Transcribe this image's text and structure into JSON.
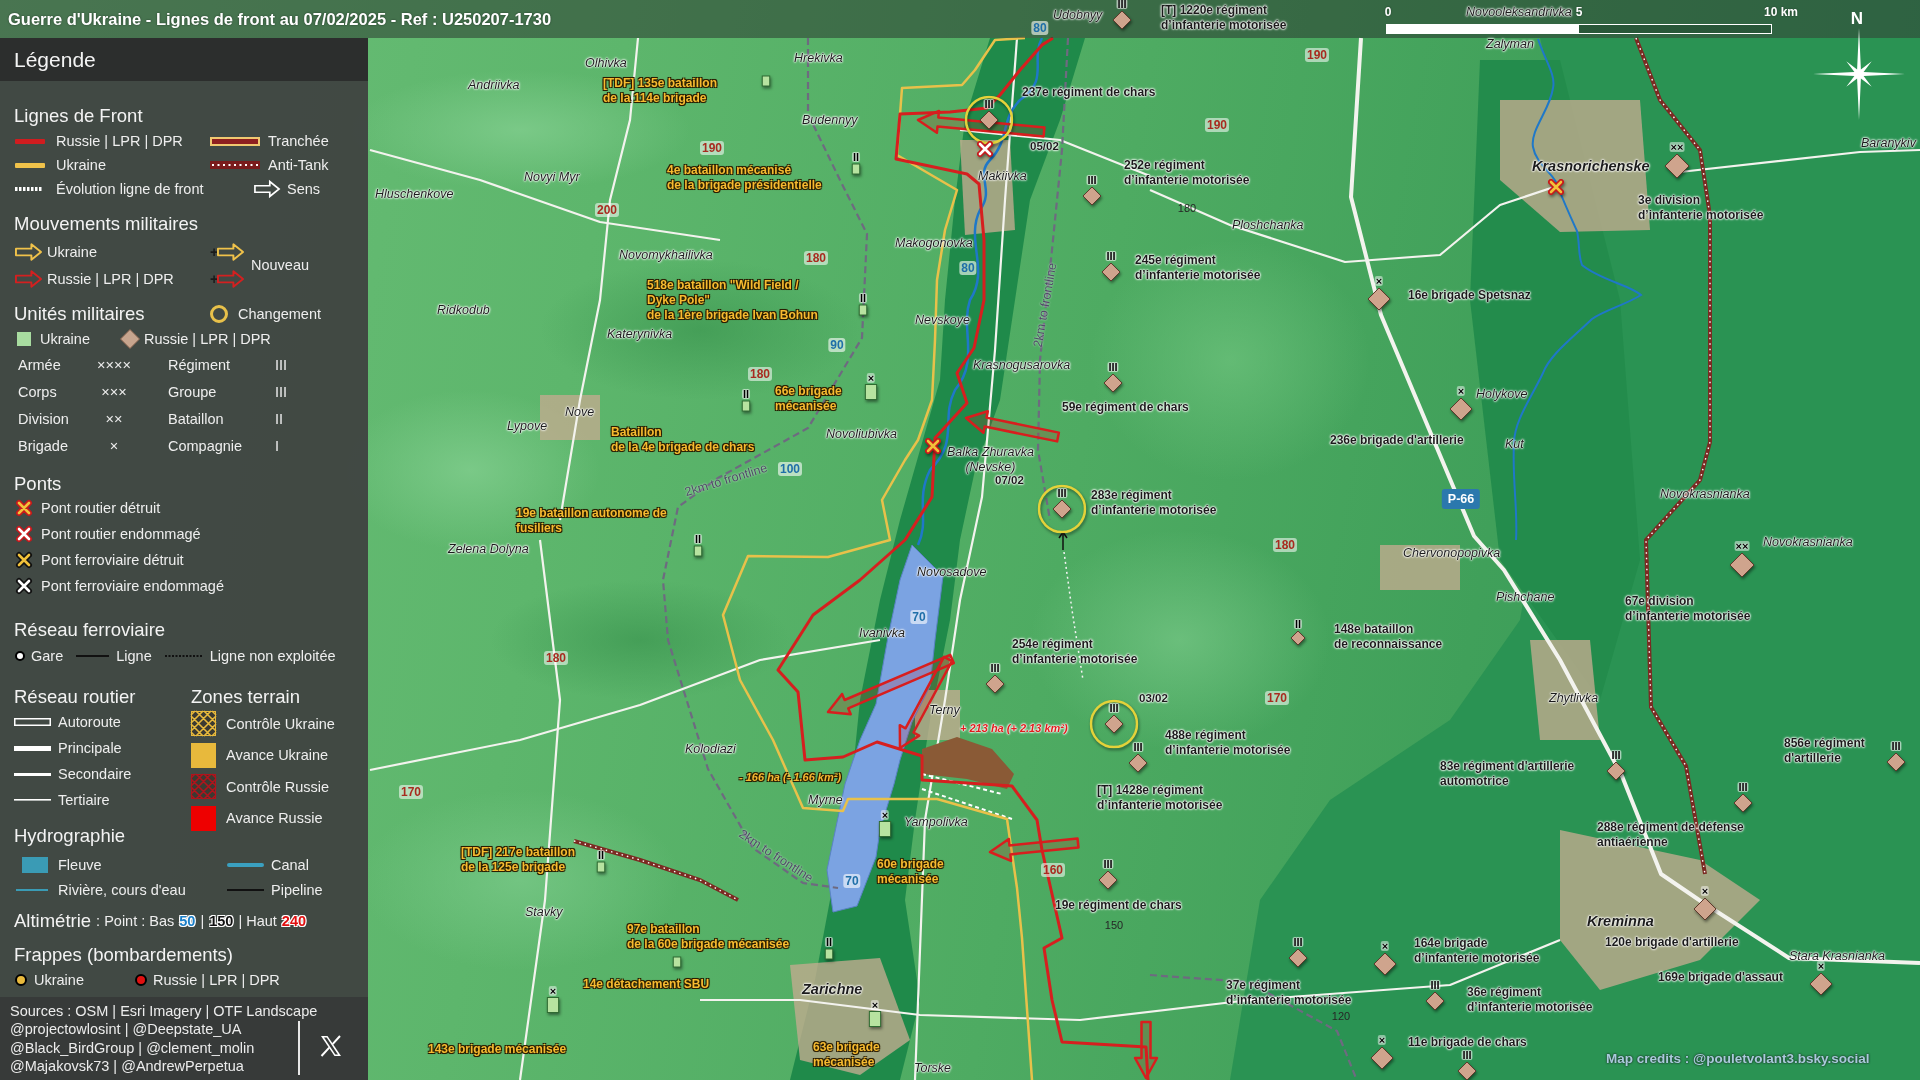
{
  "title": "Guerre d'Ukraine - Lignes de front au 07/02/2025 - Ref : U250207-1730",
  "scale_bar": {
    "labels": [
      "0",
      "5",
      "10 km"
    ]
  },
  "compass": {
    "label": "N"
  },
  "legend": {
    "title": "Légende",
    "front_lines": {
      "title": "Lignes de Front",
      "items": [
        {
          "kind": "line",
          "label": "Russie | LPR | DPR",
          "color": "#d01c1f"
        },
        {
          "kind": "trench",
          "label": "Tranchée"
        },
        {
          "kind": "line",
          "label": "Ukraine",
          "color": "#f0c24a"
        },
        {
          "kind": "antitank",
          "label": "Anti-Tank"
        },
        {
          "kind": "dotted",
          "label": "Évolution ligne de front"
        },
        {
          "kind": "arrow",
          "label": "Sens"
        }
      ]
    },
    "movements": {
      "title": "Mouvements militaires",
      "items": [
        {
          "label": "Ukraine",
          "color": "#f0c24a"
        },
        {
          "label": "Russie | LPR | DPR",
          "color": "#d42020"
        }
      ],
      "new": {
        "label": "Nouveau",
        "items": [
          {
            "sign": "+",
            "color": "#f0c24a"
          },
          {
            "sign": "+",
            "color": "#d42020"
          }
        ]
      }
    },
    "units": {
      "title": "Unités militaires",
      "change": {
        "label": "Changement"
      },
      "sides": [
        {
          "kind": "square",
          "label": "Ukraine"
        },
        {
          "kind": "diamond",
          "label": "Russie | LPR | DPR"
        }
      ],
      "echelons": [
        {
          "name": "Armée",
          "mark": "××××"
        },
        {
          "name": "Régiment",
          "mark": "III"
        },
        {
          "name": "Corps",
          "mark": "×××"
        },
        {
          "name": "Groupe",
          "mark": "III"
        },
        {
          "name": "Division",
          "mark": "××"
        },
        {
          "name": "Bataillon",
          "mark": "II"
        },
        {
          "name": "Brigade",
          "mark": "×"
        },
        {
          "name": "Compagnie",
          "mark": "I"
        }
      ]
    },
    "bridges": {
      "title": "Ponts",
      "items": [
        {
          "kind": "road",
          "destroyed": true,
          "label": "Pont routier détruit"
        },
        {
          "kind": "road",
          "destroyed": false,
          "label": "Pont routier endommagé"
        },
        {
          "kind": "rail",
          "destroyed": true,
          "label": "Pont ferroviaire détruit"
        },
        {
          "kind": "rail",
          "destroyed": false,
          "label": "Pont ferroviaire endommagé"
        }
      ]
    },
    "railway": {
      "title": "Réseau ferroviaire",
      "items": [
        {
          "kind": "station",
          "label": "Gare"
        },
        {
          "kind": "line",
          "label": "Ligne"
        },
        {
          "kind": "dashed",
          "label": "Ligne non exploitée"
        }
      ]
    },
    "roads": {
      "title": "Réseau routier",
      "items": [
        {
          "kind": "motorway",
          "label": "Autoroute"
        },
        {
          "kind": "primary",
          "label": "Principale"
        },
        {
          "kind": "secondary",
          "label": "Secondaire"
        },
        {
          "kind": "tertiary",
          "label": "Tertiaire"
        }
      ]
    },
    "zones": {
      "title": "Zones terrain",
      "items": [
        {
          "kind": "hatched",
          "label": "Contrôle Ukraine",
          "color": "#e8b93c"
        },
        {
          "kind": "solid",
          "label": "Avance Ukraine",
          "color": "#e8b93c"
        },
        {
          "kind": "hatched",
          "label": "Contrôle Russie",
          "color": "#b0141c"
        },
        {
          "kind": "solid",
          "label": "Avance Russie",
          "color": "#ee0000"
        }
      ]
    },
    "hydrography": {
      "title": "Hydrographie",
      "items": [
        {
          "kind": "area",
          "label": "Fleuve"
        },
        {
          "kind": "canal",
          "label": "Canal"
        },
        {
          "kind": "stream",
          "label": "Rivière, cours d'eau"
        },
        {
          "kind": "pipeline",
          "label": "Pipeline"
        }
      ]
    },
    "altimetry": {
      "title": "Altimétrie",
      "parts": [
        {
          "kind": "text",
          "text": ": Point : Bas"
        },
        {
          "kind": "low",
          "text": "50"
        },
        {
          "kind": "text",
          "text": "|"
        },
        {
          "kind": "mid",
          "text": "150"
        },
        {
          "kind": "text",
          "text": "| Haut"
        },
        {
          "kind": "high",
          "text": "240"
        }
      ]
    },
    "strikes": {
      "title": "Frappes (bombardements)",
      "items": [
        {
          "label": "Ukraine",
          "color": "#e8b93c"
        },
        {
          "label": "Russie | LPR | DPR",
          "color": "#e01010"
        }
      ]
    },
    "sources": [
      "Sources : OSM | Esri Imagery | OTF Landscape",
      "@projectowlosint | @Deepstate_UA",
      "@Black_BirdGroup | @clement_molin",
      "@Majakovsk73 | @AndrewPerpetua"
    ]
  },
  "map": {
    "places": [
      {
        "name": "Udobnyy",
        "kind": "village"
      },
      {
        "name": "Novooleksandrivka",
        "kind": "village"
      },
      {
        "name": "Zalyman",
        "kind": "village"
      },
      {
        "name": "Olhivka",
        "kind": "village"
      },
      {
        "name": "Hrekivka",
        "kind": "village"
      },
      {
        "name": "Andriivka",
        "kind": "village"
      },
      {
        "name": "Budennyy",
        "kind": "village"
      },
      {
        "name": "Baranykiv",
        "kind": "village"
      },
      {
        "name": "Krasnorichenske",
        "kind": "town"
      },
      {
        "name": "Novyi Myr",
        "kind": "village"
      },
      {
        "name": "Makiivka",
        "kind": "village"
      },
      {
        "name": "Hluschenkove",
        "kind": "village"
      },
      {
        "name": "Ploshchanka",
        "kind": "village"
      },
      {
        "name": "Makogonovka",
        "kind": "village"
      },
      {
        "name": "Novomykhailivka",
        "kind": "village"
      },
      {
        "name": "Ridkodub",
        "kind": "village"
      },
      {
        "name": "Nevskoye",
        "kind": "village"
      },
      {
        "name": "Katerynivka",
        "kind": "village"
      },
      {
        "name": "Krasnogusarovka",
        "kind": "village"
      },
      {
        "name": "Holykove",
        "kind": "village"
      },
      {
        "name": "Nove",
        "kind": "village"
      },
      {
        "name": "Lypove",
        "kind": "village"
      },
      {
        "name": "Novoliubivka",
        "kind": "village"
      },
      {
        "name": "Kut",
        "kind": "village"
      },
      {
        "name": "Balka Zhuravka\n(Nevske)",
        "kind": "village"
      },
      {
        "name": "Novokrasnianka",
        "kind": "village"
      },
      {
        "name": "Zelena Dolyna",
        "kind": "village"
      },
      {
        "name": "Novokrasnianka",
        "kind": "village"
      },
      {
        "name": "Chervonopopivka",
        "kind": "village"
      },
      {
        "name": "Novosadove",
        "kind": "village"
      },
      {
        "name": "Pishchane",
        "kind": "village"
      },
      {
        "name": "Ivanivka",
        "kind": "village"
      },
      {
        "name": "Zhytlivka",
        "kind": "village"
      },
      {
        "name": "Terny",
        "kind": "village"
      },
      {
        "name": "Kolodiazi",
        "kind": "village"
      },
      {
        "name": "Myrne",
        "kind": "village"
      },
      {
        "name": "Yampolivka",
        "kind": "village"
      },
      {
        "name": "Stavky",
        "kind": "village"
      },
      {
        "name": "Kreminna",
        "kind": "town"
      },
      {
        "name": "Stara Krasnianka",
        "kind": "village"
      },
      {
        "name": "Zarichne",
        "kind": "town"
      },
      {
        "name": "Torske",
        "kind": "village"
      }
    ],
    "russian_units": [
      {
        "lines": [
          "[T] 1220e régiment",
          "d’infanterie motorisée"
        ],
        "echelon": "III",
        "changed": false
      },
      {
        "lines": [
          "237e régiment de chars"
        ],
        "echelon": "III",
        "changed": true,
        "date": "05/02"
      },
      {
        "lines": [
          "252e régiment",
          "d’infanterie motorisée"
        ],
        "echelon": "III",
        "changed": false
      },
      {
        "lines": [
          "3e division",
          "d’infanterie motorisée"
        ],
        "echelon": "××",
        "changed": false
      },
      {
        "lines": [
          "245e régiment",
          "d’infanterie motorisée"
        ],
        "echelon": "III",
        "changed": false
      },
      {
        "lines": [
          "16e brigade Spetsnaz"
        ],
        "echelon": "×",
        "changed": false
      },
      {
        "lines": [
          "59e régiment de chars"
        ],
        "echelon": "III",
        "changed": false
      },
      {
        "lines": [
          "236e brigade d'artillerie"
        ],
        "echelon": "×",
        "changed": false
      },
      {
        "lines": [
          "283e régiment",
          "d’infanterie motorisée"
        ],
        "echelon": "III",
        "changed": true,
        "date": "07/02"
      },
      {
        "lines": [
          "67e division",
          "d’infanterie motorisée"
        ],
        "echelon": "××",
        "changed": false
      },
      {
        "lines": [
          "148e bataillon",
          "de reconnaissance"
        ],
        "echelon": "II",
        "changed": false
      },
      {
        "lines": [
          "254e régiment",
          "d’infanterie motorisée"
        ],
        "echelon": "III",
        "changed": false
      },
      {
        "lines": [
          "488e régiment",
          "d’infanterie motorisée"
        ],
        "echelon": "III",
        "changed": true,
        "date": "03/02"
      },
      {
        "lines": [
          "[T] 1428e régiment",
          "d’infanterie motorisée"
        ],
        "echelon": "III",
        "changed": false
      },
      {
        "lines": [
          "83e régiment d'artillerie",
          "automotrice"
        ],
        "echelon": "III",
        "changed": false
      },
      {
        "lines": [
          "856e régiment",
          "d'artillerie"
        ],
        "echelon": "III",
        "changed": false
      },
      {
        "lines": [
          "288e régiment de défense",
          "antiaérienne"
        ],
        "echelon": "III",
        "changed": false
      },
      {
        "lines": [
          "19e régiment de chars"
        ],
        "echelon": "III",
        "changed": false
      },
      {
        "lines": [
          "120e brigade d'artillerie"
        ],
        "echelon": "×",
        "changed": false
      },
      {
        "lines": [
          "37e régiment",
          "d’infanterie motorisée"
        ],
        "echelon": "III",
        "changed": false
      },
      {
        "lines": [
          "164e brigade",
          "d’infanterie motorisée"
        ],
        "echelon": "×",
        "changed": false
      },
      {
        "lines": [
          "169e brigade d'assaut"
        ],
        "echelon": "×",
        "changed": false
      },
      {
        "lines": [
          "36e régiment",
          "d’infanterie motorisée"
        ],
        "echelon": "III",
        "changed": false
      },
      {
        "lines": [
          "11e brigade de chars"
        ],
        "echelon": "×",
        "changed": false
      },
      {
        "echelon": "III",
        "changed": false
      }
    ],
    "ukrainian_units": [
      {
        "lines": [
          "[TDF] 135e bataillon",
          "de la 114e brigade"
        ],
        "changed": false
      },
      {
        "lines": [
          "4e bataillon mécanisé",
          "de la brigade présidentielle"
        ],
        "echelon": "II",
        "changed": false
      },
      {
        "lines": [
          "518e bataillon \"Wild Field /",
          "Dyke Pole\"",
          "de la 1ère brigade Ivan Bohun"
        ],
        "echelon": "II",
        "changed": false
      },
      {
        "lines": [
          "66e brigade",
          "mécanisée"
        ],
        "echelon": "×",
        "changed": false
      },
      {
        "lines": [
          "Bataillon",
          "de la 4e brigade de chars"
        ],
        "echelon": "II",
        "changed": false
      },
      {
        "lines": [
          "19e bataillon autonome de",
          "fusiliers"
        ],
        "echelon": "II",
        "changed": false
      },
      {
        "lines": [
          "[TDF] 217e bataillon",
          "de la 125e brigade"
        ],
        "echelon": "II",
        "changed": false
      },
      {
        "lines": [
          "60e brigade",
          "mécanisée"
        ],
        "echelon": "×",
        "changed": false
      },
      {
        "lines": [
          "97e bataillon",
          "de la 60e brigade mécanisée"
        ],
        "echelon": "II",
        "changed": false
      },
      {
        "lines": [
          "14e détachement SBU"
        ],
        "changed": false
      },
      {
        "lines": [
          "143e brigade mécanisée"
        ],
        "echelon": "×",
        "changed": false
      },
      {
        "lines": [
          "63e brigade",
          "mécanisée"
        ],
        "echelon": "×",
        "changed": false
      }
    ],
    "elevations": [
      {
        "value": "80",
        "kind": "water"
      },
      {
        "value": "190",
        "kind": "land"
      },
      {
        "value": "190",
        "kind": "land"
      },
      {
        "value": "190",
        "kind": "land"
      },
      {
        "value": "200",
        "kind": "land"
      },
      {
        "value": "180",
        "kind": "contour"
      },
      {
        "value": "180",
        "kind": "land"
      },
      {
        "value": "80",
        "kind": "water"
      },
      {
        "value": "90",
        "kind": "water"
      },
      {
        "value": "180",
        "kind": "land"
      },
      {
        "value": "100",
        "kind": "water"
      },
      {
        "value": "180",
        "kind": "land"
      },
      {
        "value": "70",
        "kind": "water"
      },
      {
        "value": "180",
        "kind": "land"
      },
      {
        "value": "170",
        "kind": "land"
      },
      {
        "value": "170",
        "kind": "land"
      },
      {
        "value": "160",
        "kind": "land"
      },
      {
        "value": "70",
        "kind": "water"
      },
      {
        "value": "150",
        "kind": "contour"
      },
      {
        "value": "120",
        "kind": "contour"
      }
    ],
    "road_badge": "P-66",
    "area_changes": [
      {
        "kind": "gain",
        "text": "+ 213 ha (+ 2.13 km²)"
      },
      {
        "kind": "loss",
        "text": "- 166 ha (- 1.66 km²)"
      }
    ],
    "distance_labels": [
      "2km to frontline",
      "2km to frontline",
      "2km to frontline"
    ],
    "bridges": [
      {
        "kind": "road",
        "destroyed": false
      },
      {
        "kind": "road",
        "destroyed": true
      },
      {
        "kind": "road",
        "destroyed": true
      }
    ],
    "credit": "Map credits : @pouletvolant3.bsky.social"
  }
}
